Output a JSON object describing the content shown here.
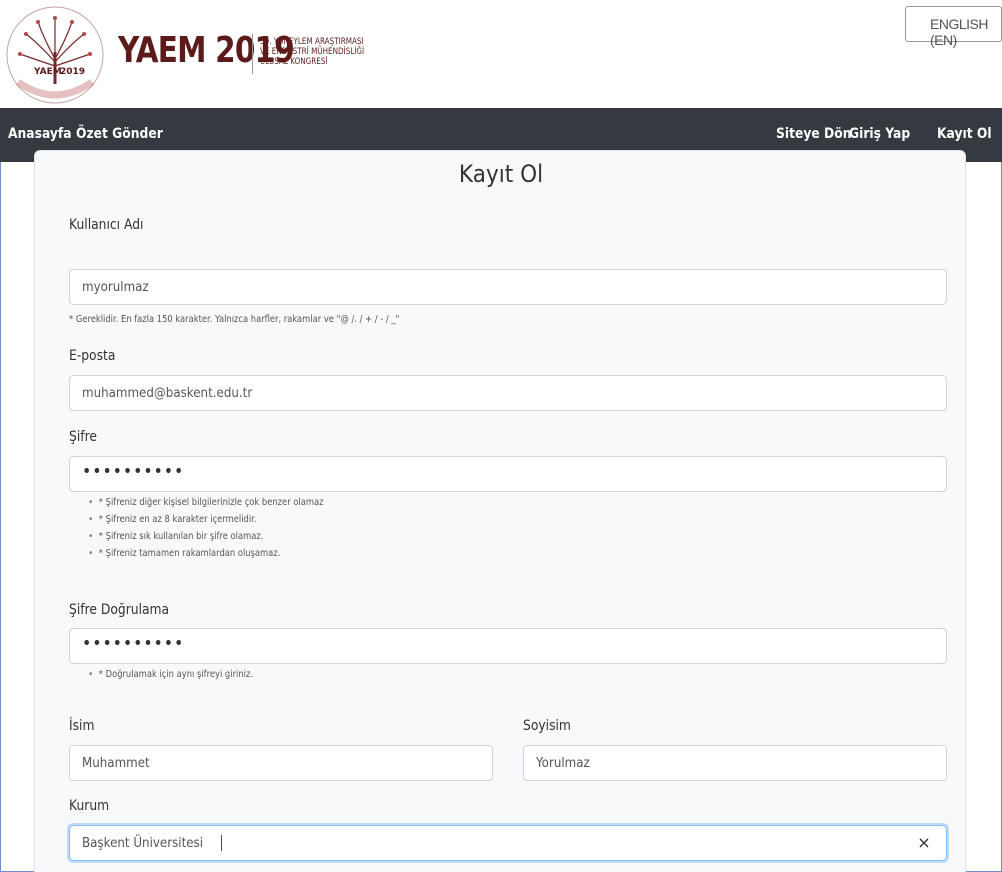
{
  "header": {
    "brand": "YAEM 2019",
    "brand_sub_line1": "39. YÖNEYLEM ARAŞTIRMASI",
    "brand_sub_line2": "VE ENDÜSTRİ MÜHENDİSLİĞİ",
    "brand_sub_line3": "ULUSAL KONGRESİ",
    "language_button": "ENGLISH (EN)"
  },
  "nav": {
    "left": [
      "Anasayfa",
      "Özet Gönder"
    ],
    "right": [
      "Siteye Dön",
      "Giriş Yap",
      "Kayıt Ol"
    ]
  },
  "form": {
    "title": "Kayıt Ol",
    "username": {
      "label": "Kullanıcı Adı",
      "value": "myorulmaz",
      "help": "* Gereklidir. En fazla 150 karakter. Yalnızca harfler, rakamlar ve \"@ /. / + / - / _\""
    },
    "email": {
      "label": "E-posta",
      "value": "muhammed@baskent.edu.tr"
    },
    "password": {
      "label": "Şifre",
      "value": "••••••••••",
      "rules": [
        "* Şifreniz diğer kişisel bilgilerinizle çok benzer olamaz",
        "* Şifreniz en az 8 karakter içermelidir.",
        "* Şifreniz sık kullanılan bir şifre olamaz.",
        "* Şifreniz tamamen rakamlardan oluşamaz."
      ]
    },
    "password_confirm": {
      "label": "Şifre Doğrulama",
      "value": "••••••••••",
      "rules": [
        "* Doğrulamak için aynı şifreyi giriniz."
      ]
    },
    "first_name": {
      "label": "İsim",
      "value": "Muhammet"
    },
    "last_name": {
      "label": "Soyisim",
      "value": "Yorulmaz"
    },
    "institution": {
      "label": "Kurum",
      "value": "Başkent Üniversitesi",
      "clear": "×"
    }
  },
  "colors": {
    "navbar": "#343a40",
    "brand": "#5c1a1a",
    "card": "#f8f9fa"
  }
}
